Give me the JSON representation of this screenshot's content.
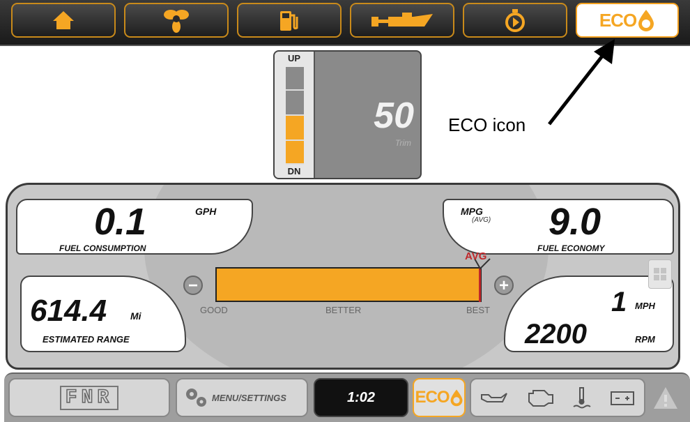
{
  "tabs": [
    {
      "name": "home-icon"
    },
    {
      "name": "propeller-icon"
    },
    {
      "name": "fuel-pump-icon"
    },
    {
      "name": "boat-icon"
    },
    {
      "name": "timer-icon"
    },
    {
      "name": "eco-tab",
      "label": "ECO"
    }
  ],
  "trim": {
    "up": "UP",
    "dn": "DN",
    "value": "50",
    "label": "Trim",
    "level": 0.5
  },
  "annotation": "ECO icon",
  "gauge": {
    "fuel_consumption": {
      "value": "0.1",
      "unit": "GPH",
      "label": "FUEL CONSUMPTION"
    },
    "fuel_economy": {
      "value": "9.0",
      "unit": "MPG",
      "sub": "(AVG)",
      "label": "FUEL ECONOMY"
    },
    "range": {
      "value": "614.4",
      "unit": "Mi",
      "label": "ESTIMATED RANGE"
    },
    "speed": {
      "value": "1",
      "unit": "MPH"
    },
    "rpm": {
      "value": "2200",
      "unit": "RPM"
    },
    "scale": {
      "good": "GOOD",
      "better": "BETTER",
      "best": "BEST",
      "avg": "AVG",
      "minus": "−",
      "plus": "+"
    }
  },
  "bottom": {
    "gear": "FNR",
    "menu": "MENU/SETTINGS",
    "time": "1:02",
    "eco": "ECO"
  },
  "colors": {
    "accent": "#f5a623",
    "avg": "#c0282b"
  }
}
